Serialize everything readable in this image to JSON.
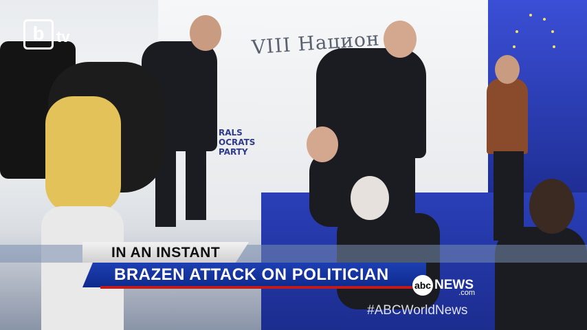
{
  "channel_logo": {
    "mark": "b",
    "suffix": "tv"
  },
  "scene": {
    "wall_text": "VIII Национ",
    "wall_sub": [
      "RALS",
      "OCRATS",
      "PARTY"
    ]
  },
  "lower_third": {
    "kicker": "IN AN INSTANT",
    "headline": "BRAZEN ATTACK ON POLITICIAN"
  },
  "network": {
    "circle": "abc",
    "name": "NEWS",
    "domain": ".com",
    "hashtag": "#ABCWorldNews"
  },
  "colors": {
    "headline_bg": "#1d3fb3",
    "red_rule": "#c21b1b",
    "stage_blue": "#2a3fb8"
  }
}
